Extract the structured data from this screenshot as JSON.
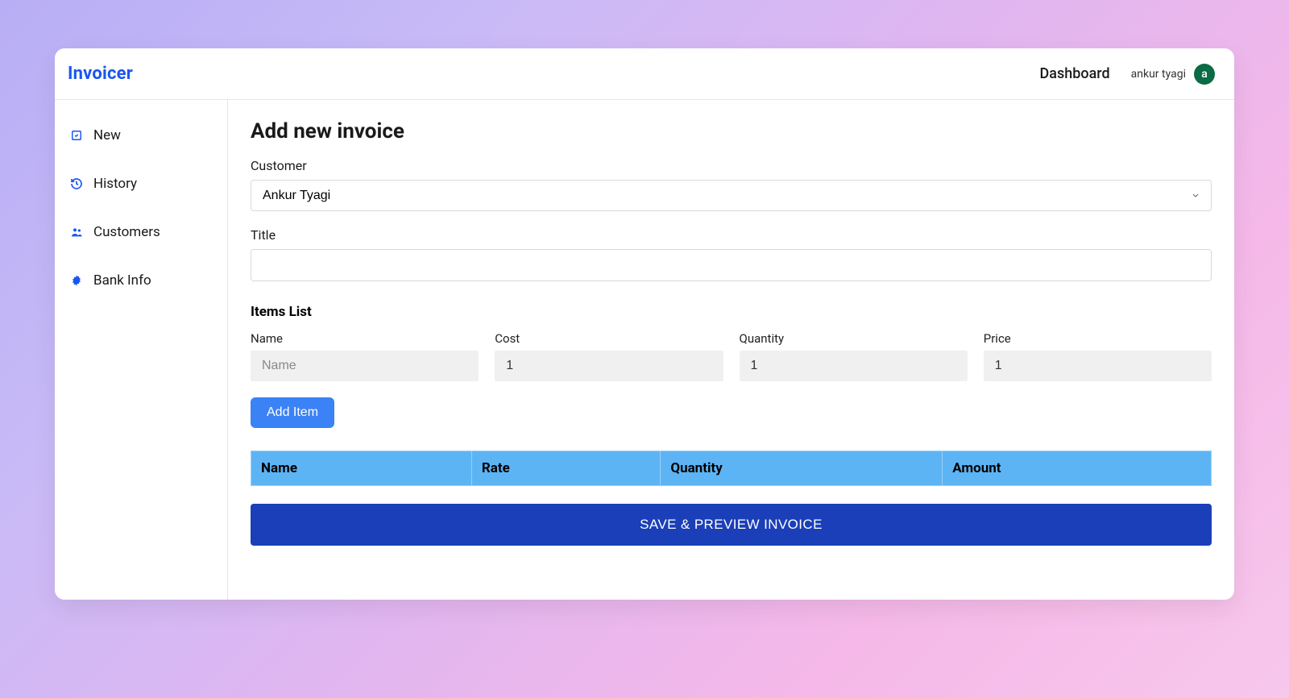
{
  "header": {
    "brand": "Invoicer",
    "dashboard": "Dashboard",
    "user_name": "ankur tyagi",
    "avatar_initial": "a"
  },
  "sidebar": {
    "items": [
      {
        "label": "New",
        "icon": "new-icon"
      },
      {
        "label": "History",
        "icon": "history-icon"
      },
      {
        "label": "Customers",
        "icon": "customers-icon"
      },
      {
        "label": "Bank Info",
        "icon": "gear-icon"
      }
    ]
  },
  "main": {
    "title": "Add new invoice",
    "customer_label": "Customer",
    "customer_value": "Ankur Tyagi",
    "title_label": "Title",
    "title_value": "",
    "items_heading": "Items List",
    "item_fields": {
      "name_label": "Name",
      "name_placeholder": "Name",
      "name_value": "",
      "cost_label": "Cost",
      "cost_value": "1",
      "quantity_label": "Quantity",
      "quantity_value": "1",
      "price_label": "Price",
      "price_value": "1"
    },
    "add_item_label": "Add Item",
    "table_headers": [
      "Name",
      "Rate",
      "Quantity",
      "Amount"
    ],
    "save_label": "SAVE & PREVIEW INVOICE"
  }
}
